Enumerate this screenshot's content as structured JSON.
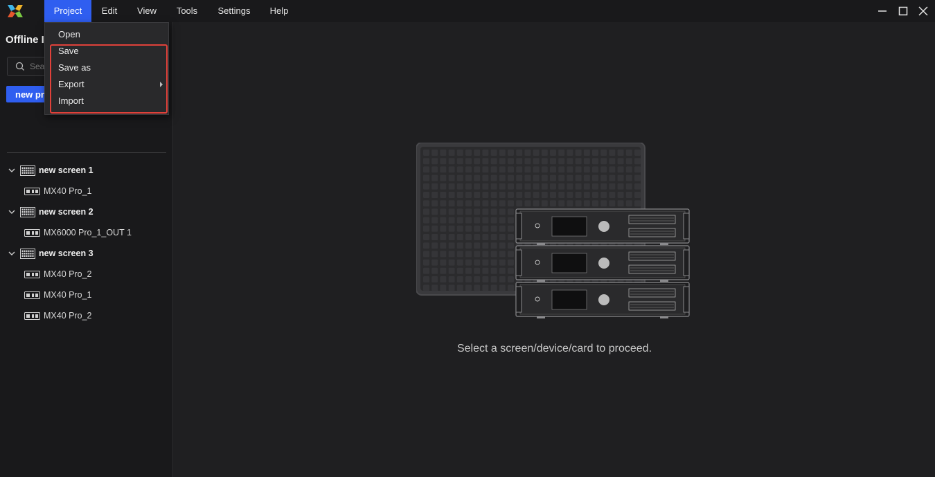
{
  "menubar": {
    "items": [
      "Project",
      "Edit",
      "View",
      "Tools",
      "Settings",
      "Help"
    ],
    "active": "Project"
  },
  "sidebar": {
    "title": "Offline I",
    "search_placeholder": "Sea",
    "new_button_label": "new pr",
    "tree": [
      {
        "type": "screen",
        "label": "new screen 1",
        "expanded": true
      },
      {
        "type": "device",
        "label": "MX40 Pro_1"
      },
      {
        "type": "screen",
        "label": "new screen 2",
        "expanded": true
      },
      {
        "type": "device",
        "label": "MX6000 Pro_1_OUT 1"
      },
      {
        "type": "screen",
        "label": "new screen 3",
        "expanded": true
      },
      {
        "type": "device",
        "label": "MX40 Pro_2"
      },
      {
        "type": "device",
        "label": "MX40 Pro_1"
      },
      {
        "type": "device",
        "label": "MX40 Pro_2"
      }
    ]
  },
  "project_menu": {
    "items": [
      {
        "label": "Open",
        "submenu": false
      },
      {
        "label": "Save",
        "submenu": false
      },
      {
        "label": "Save as",
        "submenu": false
      },
      {
        "label": "Export",
        "submenu": true
      },
      {
        "label": "Import",
        "submenu": false
      }
    ]
  },
  "main": {
    "empty_message": "Select a screen/device/card to proceed."
  },
  "colors": {
    "accent": "#2f5ef0",
    "highlight": "#e0413a",
    "background": "#1f1f21",
    "panel": "#19191b"
  },
  "icons": [
    "app-logo-icon",
    "minimize-icon",
    "maximize-icon",
    "close-icon",
    "search-icon",
    "chevron-down-icon",
    "screen-icon",
    "device-icon",
    "submenu-arrow-icon"
  ]
}
